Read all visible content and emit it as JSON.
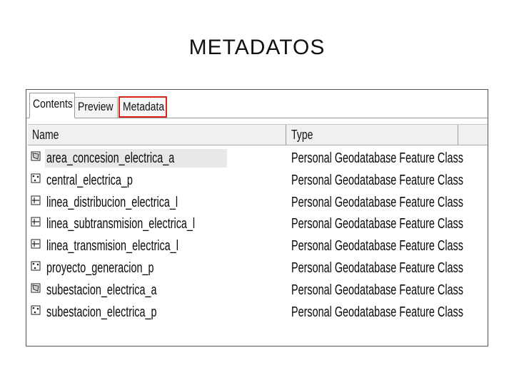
{
  "slide": {
    "title": "METADATOS"
  },
  "tabs": [
    {
      "label": "Contents",
      "active": true
    },
    {
      "label": "Preview",
      "active": false
    },
    {
      "label": "Metadata",
      "active": false,
      "highlight_color": "#d9241c"
    }
  ],
  "table": {
    "columns": [
      "Name",
      "Type"
    ],
    "rows": [
      {
        "name": "area_concesion_electrica_a",
        "type": "Personal Geodatabase Feature Class",
        "icon": "polygon-feature-class-icon",
        "selected": true
      },
      {
        "name": "central_electrica_p",
        "type": "Personal Geodatabase Feature Class",
        "icon": "point-feature-class-icon",
        "selected": false
      },
      {
        "name": "linea_distribucion_electrica_l",
        "type": "Personal Geodatabase Feature Class",
        "icon": "line-feature-class-icon",
        "selected": false
      },
      {
        "name": "linea_subtransmision_electrica_l",
        "type": "Personal Geodatabase Feature Class",
        "icon": "line-feature-class-icon",
        "selected": false
      },
      {
        "name": "linea_transmision_electrica_l",
        "type": "Personal Geodatabase Feature Class",
        "icon": "line-feature-class-icon",
        "selected": false
      },
      {
        "name": "proyecto_generacion_p",
        "type": "Personal Geodatabase Feature Class",
        "icon": "point-feature-class-icon",
        "selected": false
      },
      {
        "name": "subestacion_electrica_a",
        "type": "Personal Geodatabase Feature Class",
        "icon": "polygon-feature-class-icon",
        "selected": false
      },
      {
        "name": "subestacion_electrica_p",
        "type": "Personal Geodatabase Feature Class",
        "icon": "point-feature-class-icon",
        "selected": false
      }
    ]
  }
}
